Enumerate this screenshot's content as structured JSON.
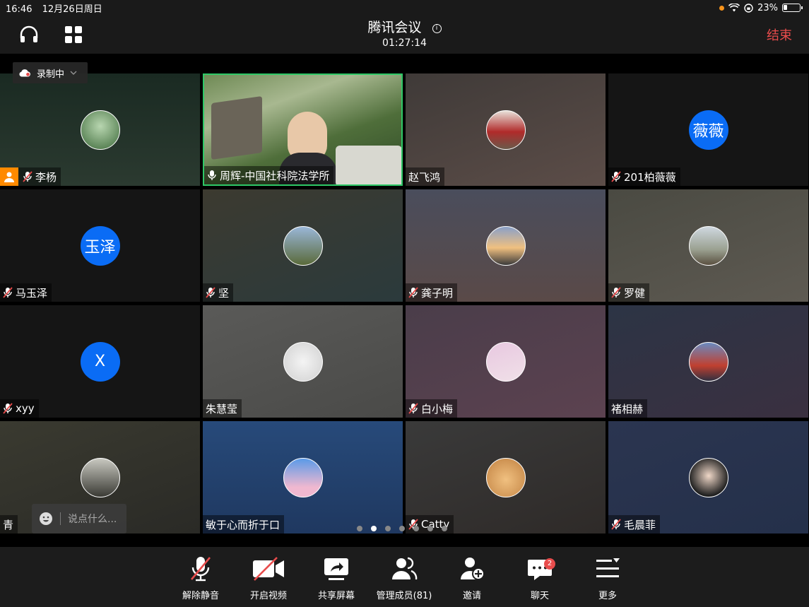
{
  "status_bar": {
    "time": "16:46",
    "date": "12月26日周日",
    "battery": "23%"
  },
  "header": {
    "title": "腾讯会议",
    "timer": "01:27:14",
    "end_label": "结束",
    "info_glyph": "i"
  },
  "recording": {
    "label": "录制中"
  },
  "participants": [
    {
      "name": "李杨",
      "muted": true,
      "host": true
    },
    {
      "name": "周辉-中国社科院法学所",
      "muted": false,
      "speaking": true
    },
    {
      "name": "赵飞鸿",
      "muted": false
    },
    {
      "name": "201柏薇薇",
      "muted": true,
      "avatar_text": "薇薇"
    },
    {
      "name": "马玉泽",
      "muted": true,
      "avatar_text": "玉泽"
    },
    {
      "name": "坚",
      "muted": true
    },
    {
      "name": "龚子明",
      "muted": true
    },
    {
      "name": "罗健",
      "muted": true
    },
    {
      "name": "xyy",
      "muted": true,
      "avatar_text": "X"
    },
    {
      "name": "朱慧莹",
      "muted": false
    },
    {
      "name": "白小梅",
      "muted": true
    },
    {
      "name": "褚相赫",
      "muted": false
    },
    {
      "name": "青",
      "muted": false
    },
    {
      "name": "敏于心而折于口",
      "muted": false
    },
    {
      "name": "Catty",
      "muted": true
    },
    {
      "name": "毛晨菲",
      "muted": true
    }
  ],
  "chat_input": {
    "placeholder": "说点什么..."
  },
  "pager": {
    "pages": 7,
    "active": 1
  },
  "toolbar": {
    "unmute": "解除静音",
    "video": "开启视频",
    "share": "共享屏幕",
    "members": "管理成员(81)",
    "invite": "邀请",
    "chat": "聊天",
    "chat_badge": "2",
    "more": "更多"
  },
  "colors": {
    "accent_blue": "#0a6cf5",
    "end_red": "#e84c4c",
    "speaker_green": "#2ec866",
    "host_orange": "#ff8a00"
  }
}
